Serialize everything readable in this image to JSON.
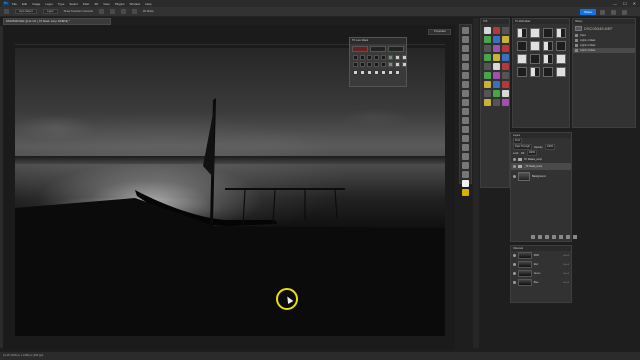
{
  "app": {
    "logo": "Ps",
    "menus": [
      "File",
      "Edit",
      "Image",
      "Layer",
      "Type",
      "Select",
      "Filter",
      "3D",
      "View",
      "Plugins",
      "Window",
      "Help"
    ],
    "window_controls": [
      "—",
      "☐",
      "✕"
    ]
  },
  "options_bar": {
    "auto_select_label": "Auto-Select:",
    "layer_value": "Layer",
    "show_transform_label": "Show Transform Controls",
    "mode_label": "3D Mode:",
    "share_label": "Share"
  },
  "document": {
    "tab_title": "DSC05345.NEF @ 41.1% (_TK Mask: temp: RGB/16) *",
    "status_text": "41.1%   6240 px x 4160 px (240 ppi)"
  },
  "properties_tab": {
    "label": "Properties"
  },
  "tklm_panel": {
    "title": "TK Lum Mask"
  },
  "panel_tklm5": {
    "title": "TK5"
  },
  "panel_multimasks": {
    "title": "TK Multi-Mask"
  },
  "history": {
    "title": "History",
    "snapshot_label": "DSC05345.NEF",
    "items": [
      "Open",
      "Lights 1 Mask",
      "Lights 2 Mask",
      "Lights 3 Mask"
    ]
  },
  "layers": {
    "title": "Layers",
    "kind_label": "Kind",
    "blend_mode": "Pass Through",
    "opacity_label": "Opacity:",
    "opacity_value": "100%",
    "lock_label": "Lock:",
    "fill_label": "Fill:",
    "fill_value": "100%",
    "groups": [
      "TK Masks_temp",
      "_TK Mask_temp"
    ],
    "background_label": "Background"
  },
  "channels": {
    "title": "Channels",
    "rows": [
      {
        "name": "RGB",
        "key": "Ctrl+2"
      },
      {
        "name": "Red",
        "key": "Ctrl+3"
      },
      {
        "name": "Green",
        "key": "Ctrl+4"
      },
      {
        "name": "Blue",
        "key": "Ctrl+5"
      }
    ]
  },
  "colors": {
    "accent": "#1473e6",
    "cursor_highlight": "#e8e200",
    "foreground_swatch": "#f0f0f0",
    "background_swatch": "#d8b200"
  },
  "icons": [
    "move-icon",
    "marquee-icon",
    "lasso-icon",
    "crop-icon",
    "eyedropper-icon",
    "brush-icon",
    "eraser-icon",
    "gradient-icon",
    "pen-icon",
    "type-icon",
    "hand-icon",
    "zoom-icon"
  ]
}
